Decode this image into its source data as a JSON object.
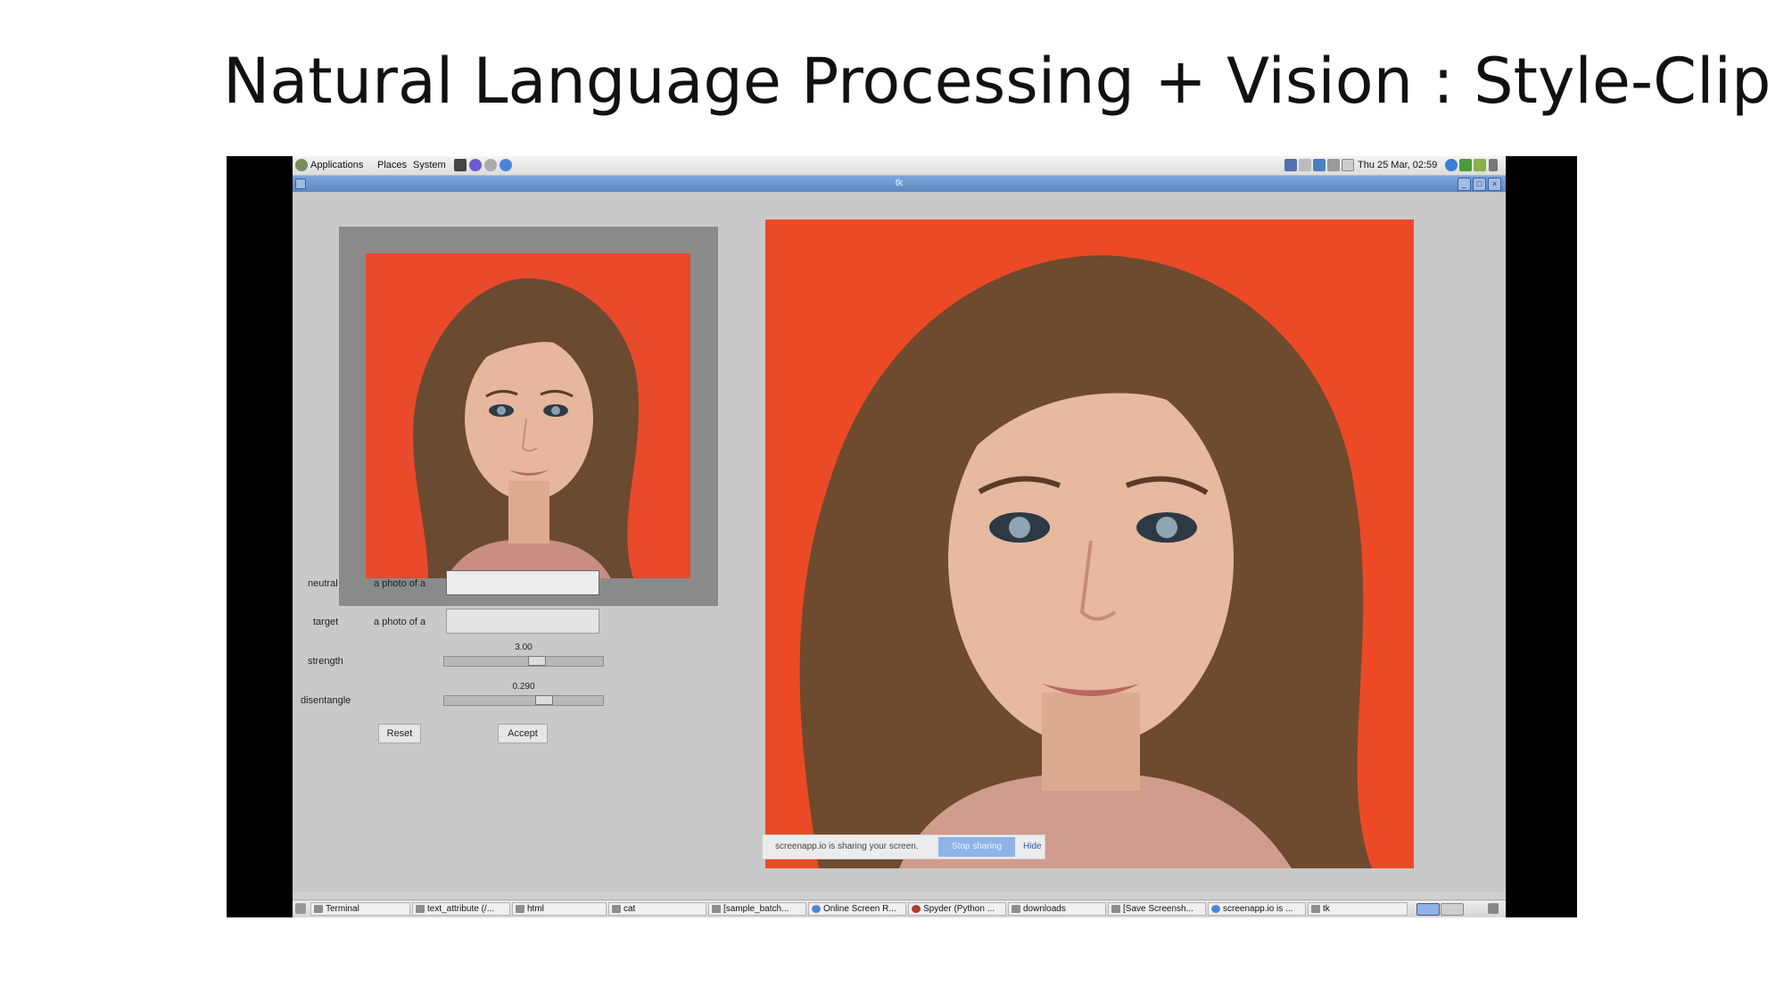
{
  "slide": {
    "title": "Natural Language Processing + Vision : Style-Clip"
  },
  "top_panel": {
    "menus": [
      "Applications",
      "Places",
      "System"
    ],
    "clock": "Thu 25 Mar, 02:59"
  },
  "window": {
    "title": "tk"
  },
  "form": {
    "neutral_label": "neutral",
    "neutral_prefix": "a photo of a",
    "neutral_value": "",
    "target_label": "target",
    "target_prefix": "a photo of a",
    "target_value": "",
    "strength_label": "strength",
    "strength_value": "3.00",
    "disentangle_label": "disentangle",
    "disentangle_value": "0.290",
    "reset_label": "Reset",
    "accept_label": "Accept"
  },
  "share_bar": {
    "message": "screenapp.io is sharing your screen.",
    "stop_label": "Stop sharing",
    "hide_label": "Hide"
  },
  "taskbar": {
    "items": [
      "Terminal",
      "text_attribute (/...",
      "html",
      "cat",
      "[sample_batch...",
      "Online Screen R...",
      "Spyder (Python ...",
      "downloads",
      "[Save Screensh...",
      "screenapp.io is ...",
      "tk"
    ]
  },
  "colors": {
    "photo_background": "#ea4a2a",
    "titlebar": "#6b93cc",
    "app_background": "#c9c9c9"
  }
}
